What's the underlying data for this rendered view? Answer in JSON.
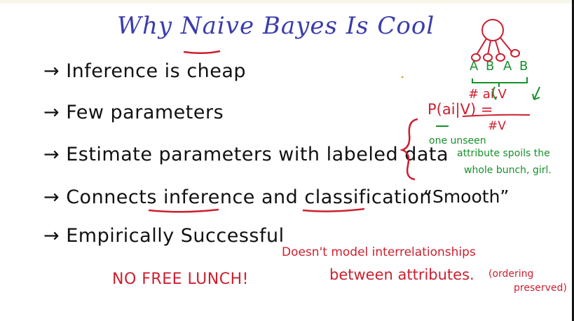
{
  "title": "Why Naive Bayes Is Cool",
  "bullets": [
    "→ Inference is cheap",
    "→ Few parameters",
    "→ Estimate parameters with labeled data",
    "→ Connects inference and classification",
    "→ Empirically Successful"
  ],
  "smooth_note": "“Smooth”",
  "red_notes": {
    "no_free_lunch": "NO FREE LUNCH!",
    "doesnt_line1": "Doesn't model interrelationships",
    "doesnt_line2": "between attributes.",
    "ordering": "(ordering",
    "preserved": "preserved)"
  },
  "formula": {
    "lhs": "P(ai|V) =",
    "numerator": "# ai,V",
    "denominator": "#V"
  },
  "green_note": {
    "line1": "one unseen",
    "line2": "attribute spoils the",
    "line3": "whole bunch, girl."
  },
  "diagram_labels": [
    "A",
    "B",
    "A",
    "B"
  ],
  "colors": {
    "title": "#3b3dab",
    "ink": "#111111",
    "red": "#cc1f2f",
    "green": "#16902b"
  }
}
